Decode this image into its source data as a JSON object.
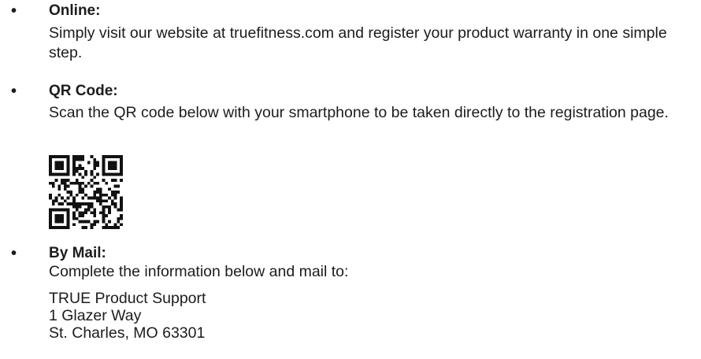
{
  "items": [
    {
      "bullet": "•",
      "heading": "Online:",
      "text": "Simply visit our website at truefitness.com and register your product warranty in one simple step."
    },
    {
      "bullet": "•",
      "heading": "QR Code:",
      "text": "Scan the QR code below with your smartphone to be taken directly to the registration page."
    },
    {
      "bullet": "•",
      "heading": "By Mail:",
      "text": "Complete the information below and mail to:",
      "address": [
        "TRUE Product Support",
        "1 Glazer Way",
        "St. Charles, MO 63301"
      ]
    }
  ],
  "qr_code": {
    "icon": "qr-code-icon",
    "color": "#111111"
  }
}
